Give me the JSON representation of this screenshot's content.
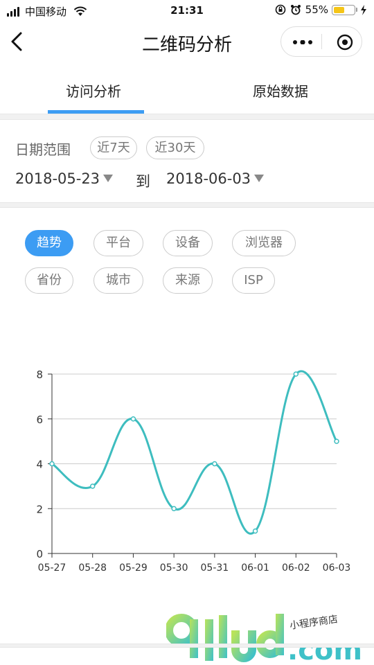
{
  "status_bar": {
    "carrier": "中国移动",
    "time": "21:31",
    "battery_percent": "55%",
    "battery_level": 0.55
  },
  "nav": {
    "title": "二维码分析"
  },
  "tabs": [
    {
      "label": "访问分析",
      "active": true
    },
    {
      "label": "原始数据",
      "active": false
    }
  ],
  "date_range": {
    "label": "日期范围",
    "quick": [
      "近7天",
      "近30天"
    ],
    "start": "2018-05-23",
    "to": "到",
    "end": "2018-06-03"
  },
  "filters": {
    "row1": [
      "趋势",
      "平台",
      "设备",
      "浏览器"
    ],
    "row2": [
      "省份",
      "城市",
      "来源",
      "ISP"
    ],
    "active": "趋势"
  },
  "chart_data": {
    "type": "line",
    "x": [
      "05-27",
      "05-28",
      "05-29",
      "05-30",
      "05-31",
      "06-01",
      "06-02",
      "06-03"
    ],
    "series": [
      {
        "values": [
          4,
          3,
          6,
          2,
          4,
          1,
          8,
          5
        ]
      }
    ],
    "yticks": [
      0,
      2,
      4,
      6,
      8
    ],
    "ylim": [
      0,
      8
    ],
    "grid": true,
    "line_color": "#3ebdbf"
  },
  "watermark": {
    "url": ".com",
    "sub": "小程序商店"
  },
  "colors": {
    "accent": "#3c9cf3",
    "chart_line": "#3ebdbf"
  }
}
